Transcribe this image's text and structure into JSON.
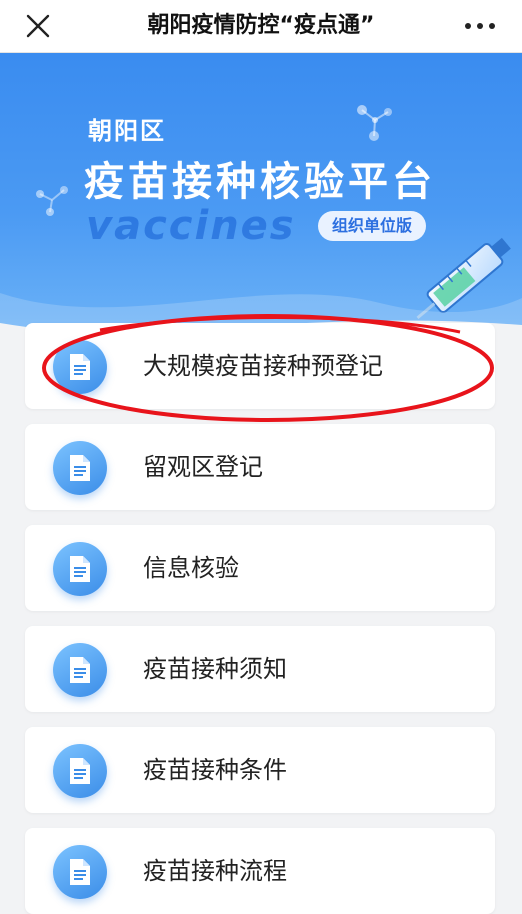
{
  "header": {
    "title": "朝阳疫情防控“疫点通”"
  },
  "banner": {
    "district": "朝阳区",
    "platform_title": "疫苗接种核验平台",
    "english_word": "vaccines",
    "edition_badge": "组织单位版"
  },
  "menu": {
    "items": [
      {
        "label": "大规模疫苗接种预登记"
      },
      {
        "label": "留观区登记"
      },
      {
        "label": "信息核验"
      },
      {
        "label": "疫苗接种须知"
      },
      {
        "label": "疫苗接种条件"
      },
      {
        "label": "疫苗接种流程"
      }
    ]
  },
  "icons": {
    "close": "close-icon",
    "more": "more-icon",
    "document": "document-icon"
  },
  "colors": {
    "banner_blue": "#3a8cf0",
    "annotation_red": "#e8141b"
  }
}
